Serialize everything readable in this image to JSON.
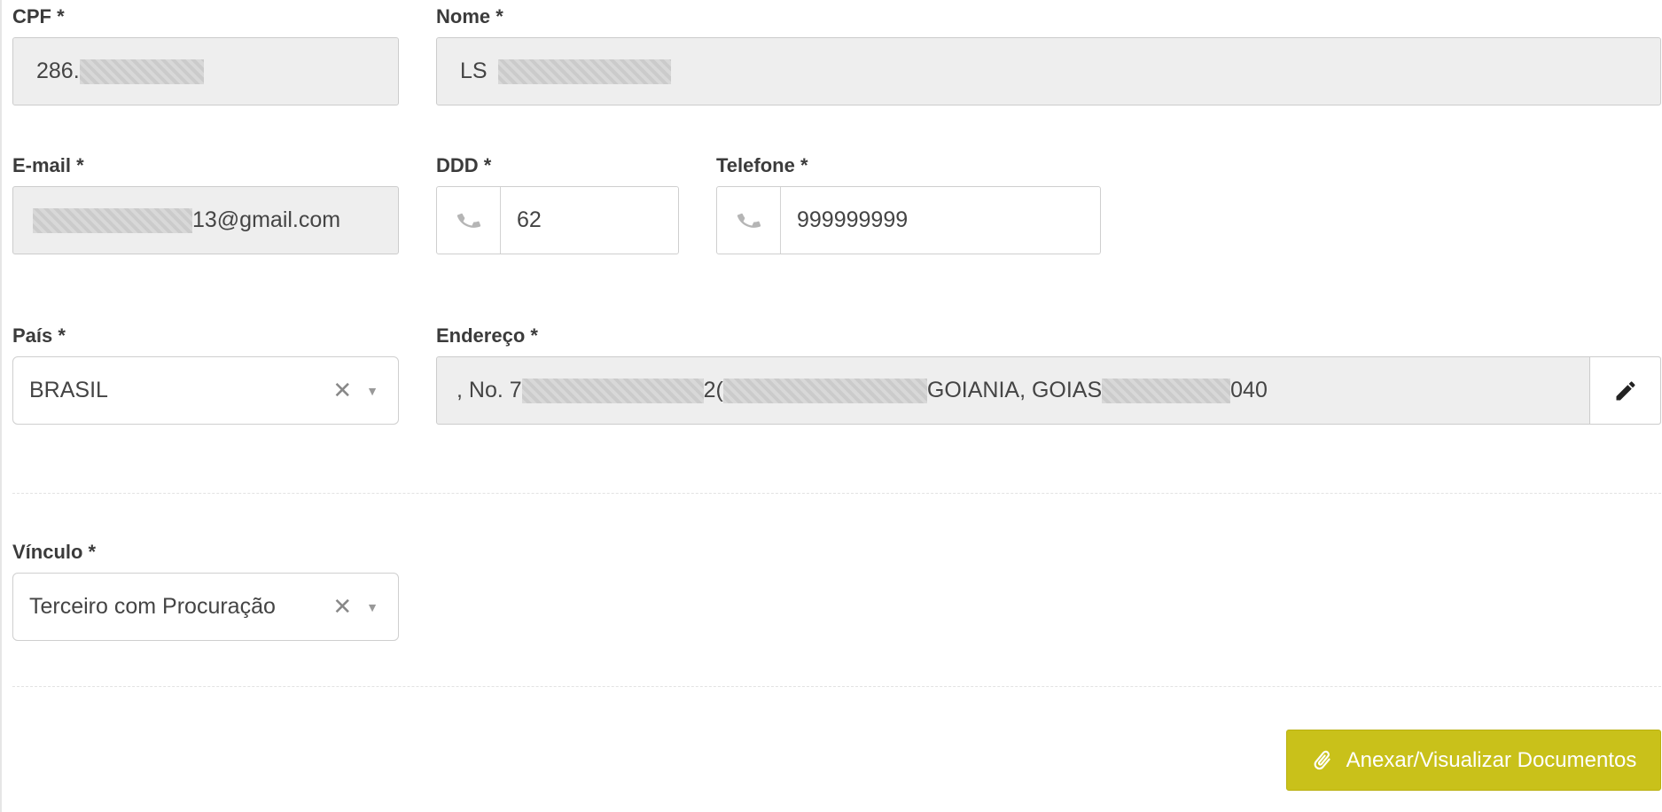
{
  "cpf": {
    "label": "CPF *",
    "value_prefix": "286."
  },
  "nome": {
    "label": "Nome *",
    "value_prefix": "LS"
  },
  "email": {
    "label": "E-mail *",
    "value_suffix": "13@gmail.com"
  },
  "ddd": {
    "label": "DDD *",
    "value": "62",
    "icon": "phone-icon"
  },
  "telefone": {
    "label": "Telefone *",
    "value": "999999999",
    "icon": "phone-icon"
  },
  "pais": {
    "label": "País *",
    "selected": "BRASIL",
    "clear_symbol": "✕",
    "arrow_symbol": "▼"
  },
  "endereco": {
    "label": "Endereço *",
    "part1": ", No. 7",
    "part2": "2(",
    "part3": "GOIANIA, GOIAS",
    "part4": "040",
    "edit_icon": "pencil-icon"
  },
  "vinculo": {
    "label": "Vínculo *",
    "selected": "Terceiro com Procuração",
    "clear_symbol": "✕",
    "arrow_symbol": "▼"
  },
  "actions": {
    "attach_label": "Anexar/Visualizar Documentos",
    "attach_icon": "paperclip-icon",
    "accent_color": "#c9c11a"
  }
}
